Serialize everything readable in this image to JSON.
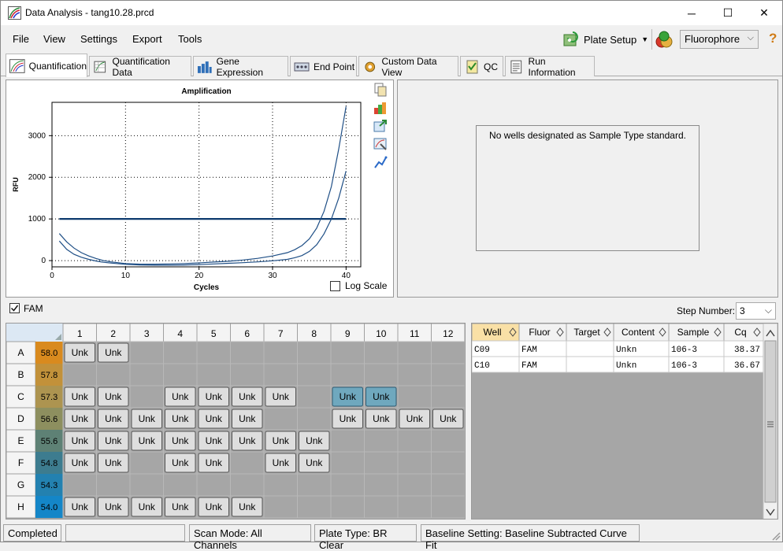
{
  "window": {
    "title": "Data Analysis - tang10.28.prcd",
    "minimize": "─",
    "maximize": "☐",
    "close": "✕"
  },
  "menu": {
    "file": "File",
    "view": "View",
    "settings": "Settings",
    "export": "Export",
    "tools": "Tools"
  },
  "toolbar": {
    "plate_setup": "Plate Setup",
    "fluorophore": "Fluorophore",
    "help": "?"
  },
  "tabs": [
    {
      "label": "Quantification"
    },
    {
      "label": "Quantification Data"
    },
    {
      "label": "Gene Expression"
    },
    {
      "label": "End Point"
    },
    {
      "label": "Custom Data View"
    },
    {
      "label": "QC"
    },
    {
      "label": "Run Information"
    }
  ],
  "chart_data": {
    "type": "line",
    "title": "Amplification",
    "xlabel": "Cycles",
    "ylabel": "RFU",
    "xlim": [
      0,
      42
    ],
    "ylim": [
      -150,
      3800
    ],
    "xticks": [
      0,
      10,
      20,
      30,
      40
    ],
    "yticks": [
      0,
      1000,
      2000,
      3000
    ],
    "grid": "dotted",
    "threshold": 1000,
    "series": [
      {
        "x": [
          1,
          2,
          3,
          4,
          5,
          6,
          7,
          8,
          10,
          12,
          14,
          16,
          18,
          20,
          22,
          24,
          26,
          28,
          30,
          32,
          33,
          34,
          35,
          36,
          37,
          38,
          39,
          40
        ],
        "values": [
          650,
          450,
          300,
          190,
          110,
          50,
          0,
          -30,
          -70,
          -85,
          -85,
          -80,
          -70,
          -55,
          -35,
          -15,
          15,
          55,
          110,
          190,
          260,
          360,
          520,
          780,
          1180,
          1780,
          2680,
          3700
        ]
      },
      {
        "x": [
          1,
          2,
          3,
          4,
          5,
          6,
          7,
          8,
          10,
          12,
          14,
          16,
          18,
          20,
          22,
          24,
          26,
          28,
          30,
          32,
          33,
          34,
          35,
          36,
          37,
          38,
          39,
          40
        ],
        "values": [
          470,
          270,
          150,
          80,
          30,
          -10,
          -40,
          -60,
          -90,
          -105,
          -110,
          -110,
          -105,
          -95,
          -80,
          -65,
          -50,
          -30,
          -5,
          30,
          70,
          120,
          220,
          380,
          640,
          1000,
          1500,
          2150
        ]
      }
    ]
  },
  "log_scale_label": "Log Scale",
  "standards_message": "No wells designated as Sample Type standard.",
  "fam_label": "FAM",
  "step_number_label": "Step Number:",
  "step_number_value": "3",
  "plate": {
    "columns": [
      "1",
      "2",
      "3",
      "4",
      "5",
      "6",
      "7",
      "8",
      "9",
      "10",
      "11",
      "12"
    ],
    "rows": [
      {
        "label": "A",
        "temp": "58.0",
        "color": "#d98a1e",
        "wells": [
          "Unk",
          "Unk",
          "",
          "",
          "",
          "",
          "",
          "",
          "",
          "",
          "",
          ""
        ]
      },
      {
        "label": "B",
        "temp": "57.8",
        "color": "#c2913a",
        "wells": [
          "",
          "",
          "",
          "",
          "",
          "",
          "",
          "",
          "",
          "",
          "",
          ""
        ]
      },
      {
        "label": "C",
        "temp": "57.3",
        "color": "#ad9450",
        "wells": [
          "Unk",
          "Unk",
          "",
          "Unk",
          "Unk",
          "Unk",
          "Unk",
          "",
          "Unk",
          "Unk",
          "",
          ""
        ]
      },
      {
        "label": "D",
        "temp": "56.6",
        "color": "#8d8f5f",
        "wells": [
          "Unk",
          "Unk",
          "Unk",
          "Unk",
          "Unk",
          "Unk",
          "",
          "",
          "Unk",
          "Unk",
          "Unk",
          "Unk"
        ]
      },
      {
        "label": "E",
        "temp": "55.6",
        "color": "#5e8175",
        "wells": [
          "Unk",
          "Unk",
          "Unk",
          "Unk",
          "Unk",
          "Unk",
          "Unk",
          "Unk",
          "",
          "",
          "",
          ""
        ]
      },
      {
        "label": "F",
        "temp": "54.8",
        "color": "#3d7c8f",
        "wells": [
          "Unk",
          "Unk",
          "",
          "Unk",
          "Unk",
          "",
          "Unk",
          "Unk",
          "",
          "",
          "",
          ""
        ]
      },
      {
        "label": "G",
        "temp": "54.3",
        "color": "#2381b0",
        "wells": [
          "",
          "",
          "",
          "",
          "",
          "",
          "",
          "",
          "",
          "",
          "",
          ""
        ]
      },
      {
        "label": "H",
        "temp": "54.0",
        "color": "#1486c8",
        "wells": [
          "Unk",
          "Unk",
          "Unk",
          "Unk",
          "Unk",
          "Unk",
          "",
          "",
          "",
          "",
          "",
          ""
        ]
      }
    ],
    "selected": [
      "C9",
      "C10"
    ]
  },
  "well_table": {
    "headers": [
      "Well",
      "Fluor",
      "Target",
      "Content",
      "Sample",
      "Cq"
    ],
    "rows": [
      [
        "C09",
        "FAM",
        "",
        "Unkn",
        "106-3",
        "38.37"
      ],
      [
        "C10",
        "FAM",
        "",
        "Unkn",
        "106-3",
        "36.67"
      ]
    ]
  },
  "status": {
    "completed": "Completed",
    "scan_mode": "Scan Mode: All Channels",
    "plate_type": "Plate Type: BR Clear",
    "baseline": "Baseline Setting: Baseline Subtracted Curve Fit"
  }
}
